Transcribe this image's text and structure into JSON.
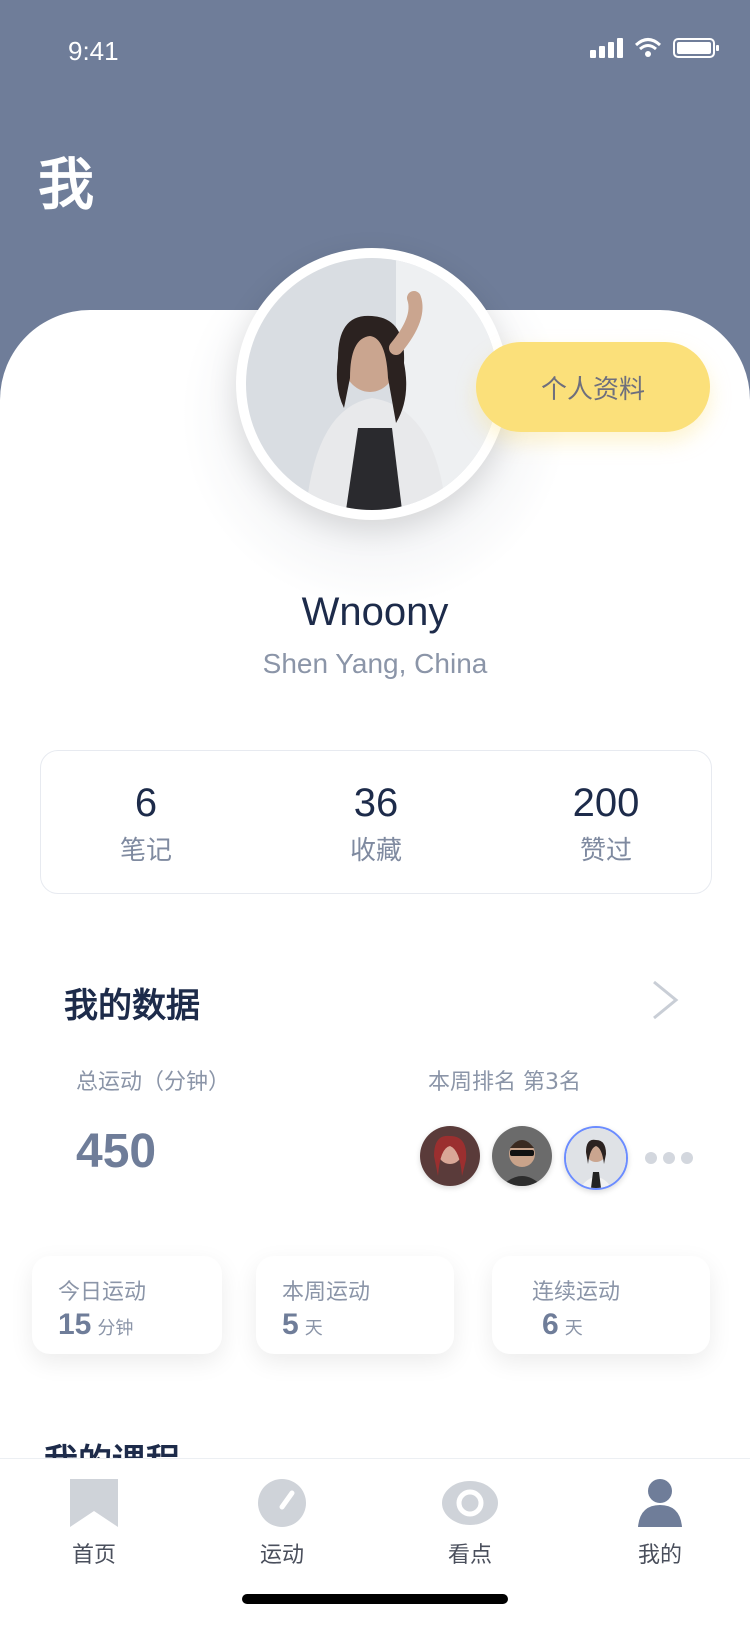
{
  "status": {
    "time": "9:41"
  },
  "header": {
    "title": "我"
  },
  "profile": {
    "button_label": "个人资料",
    "name": "Wnoony",
    "location": "Shen Yang, China"
  },
  "stats": [
    {
      "value": "6",
      "label": "笔记"
    },
    {
      "value": "36",
      "label": "收藏"
    },
    {
      "value": "200",
      "label": "赞过"
    }
  ],
  "my_data": {
    "title": "我的数据",
    "total_label": "总运动（分钟）",
    "total_value": "450",
    "rank_label": "本周排名 第3名"
  },
  "summary_cards": [
    {
      "label": "今日运动",
      "value": "15",
      "unit": "分钟"
    },
    {
      "label": "本周运动",
      "value": "5",
      "unit": "天"
    },
    {
      "label": "连续运动",
      "value": "6",
      "unit": "天"
    }
  ],
  "courses": {
    "title": "我的课程"
  },
  "tabbar": [
    {
      "label": "首页",
      "icon": "bookmark-icon"
    },
    {
      "label": "运动",
      "icon": "dashboard-icon"
    },
    {
      "label": "看点",
      "icon": "eye-icon"
    },
    {
      "label": "我的",
      "icon": "user-icon"
    }
  ],
  "colors": {
    "header": "#6f7d99",
    "accent_yellow": "#fbe07a",
    "text_dark": "#1d2b4a",
    "text_muted": "#8b95a8"
  }
}
